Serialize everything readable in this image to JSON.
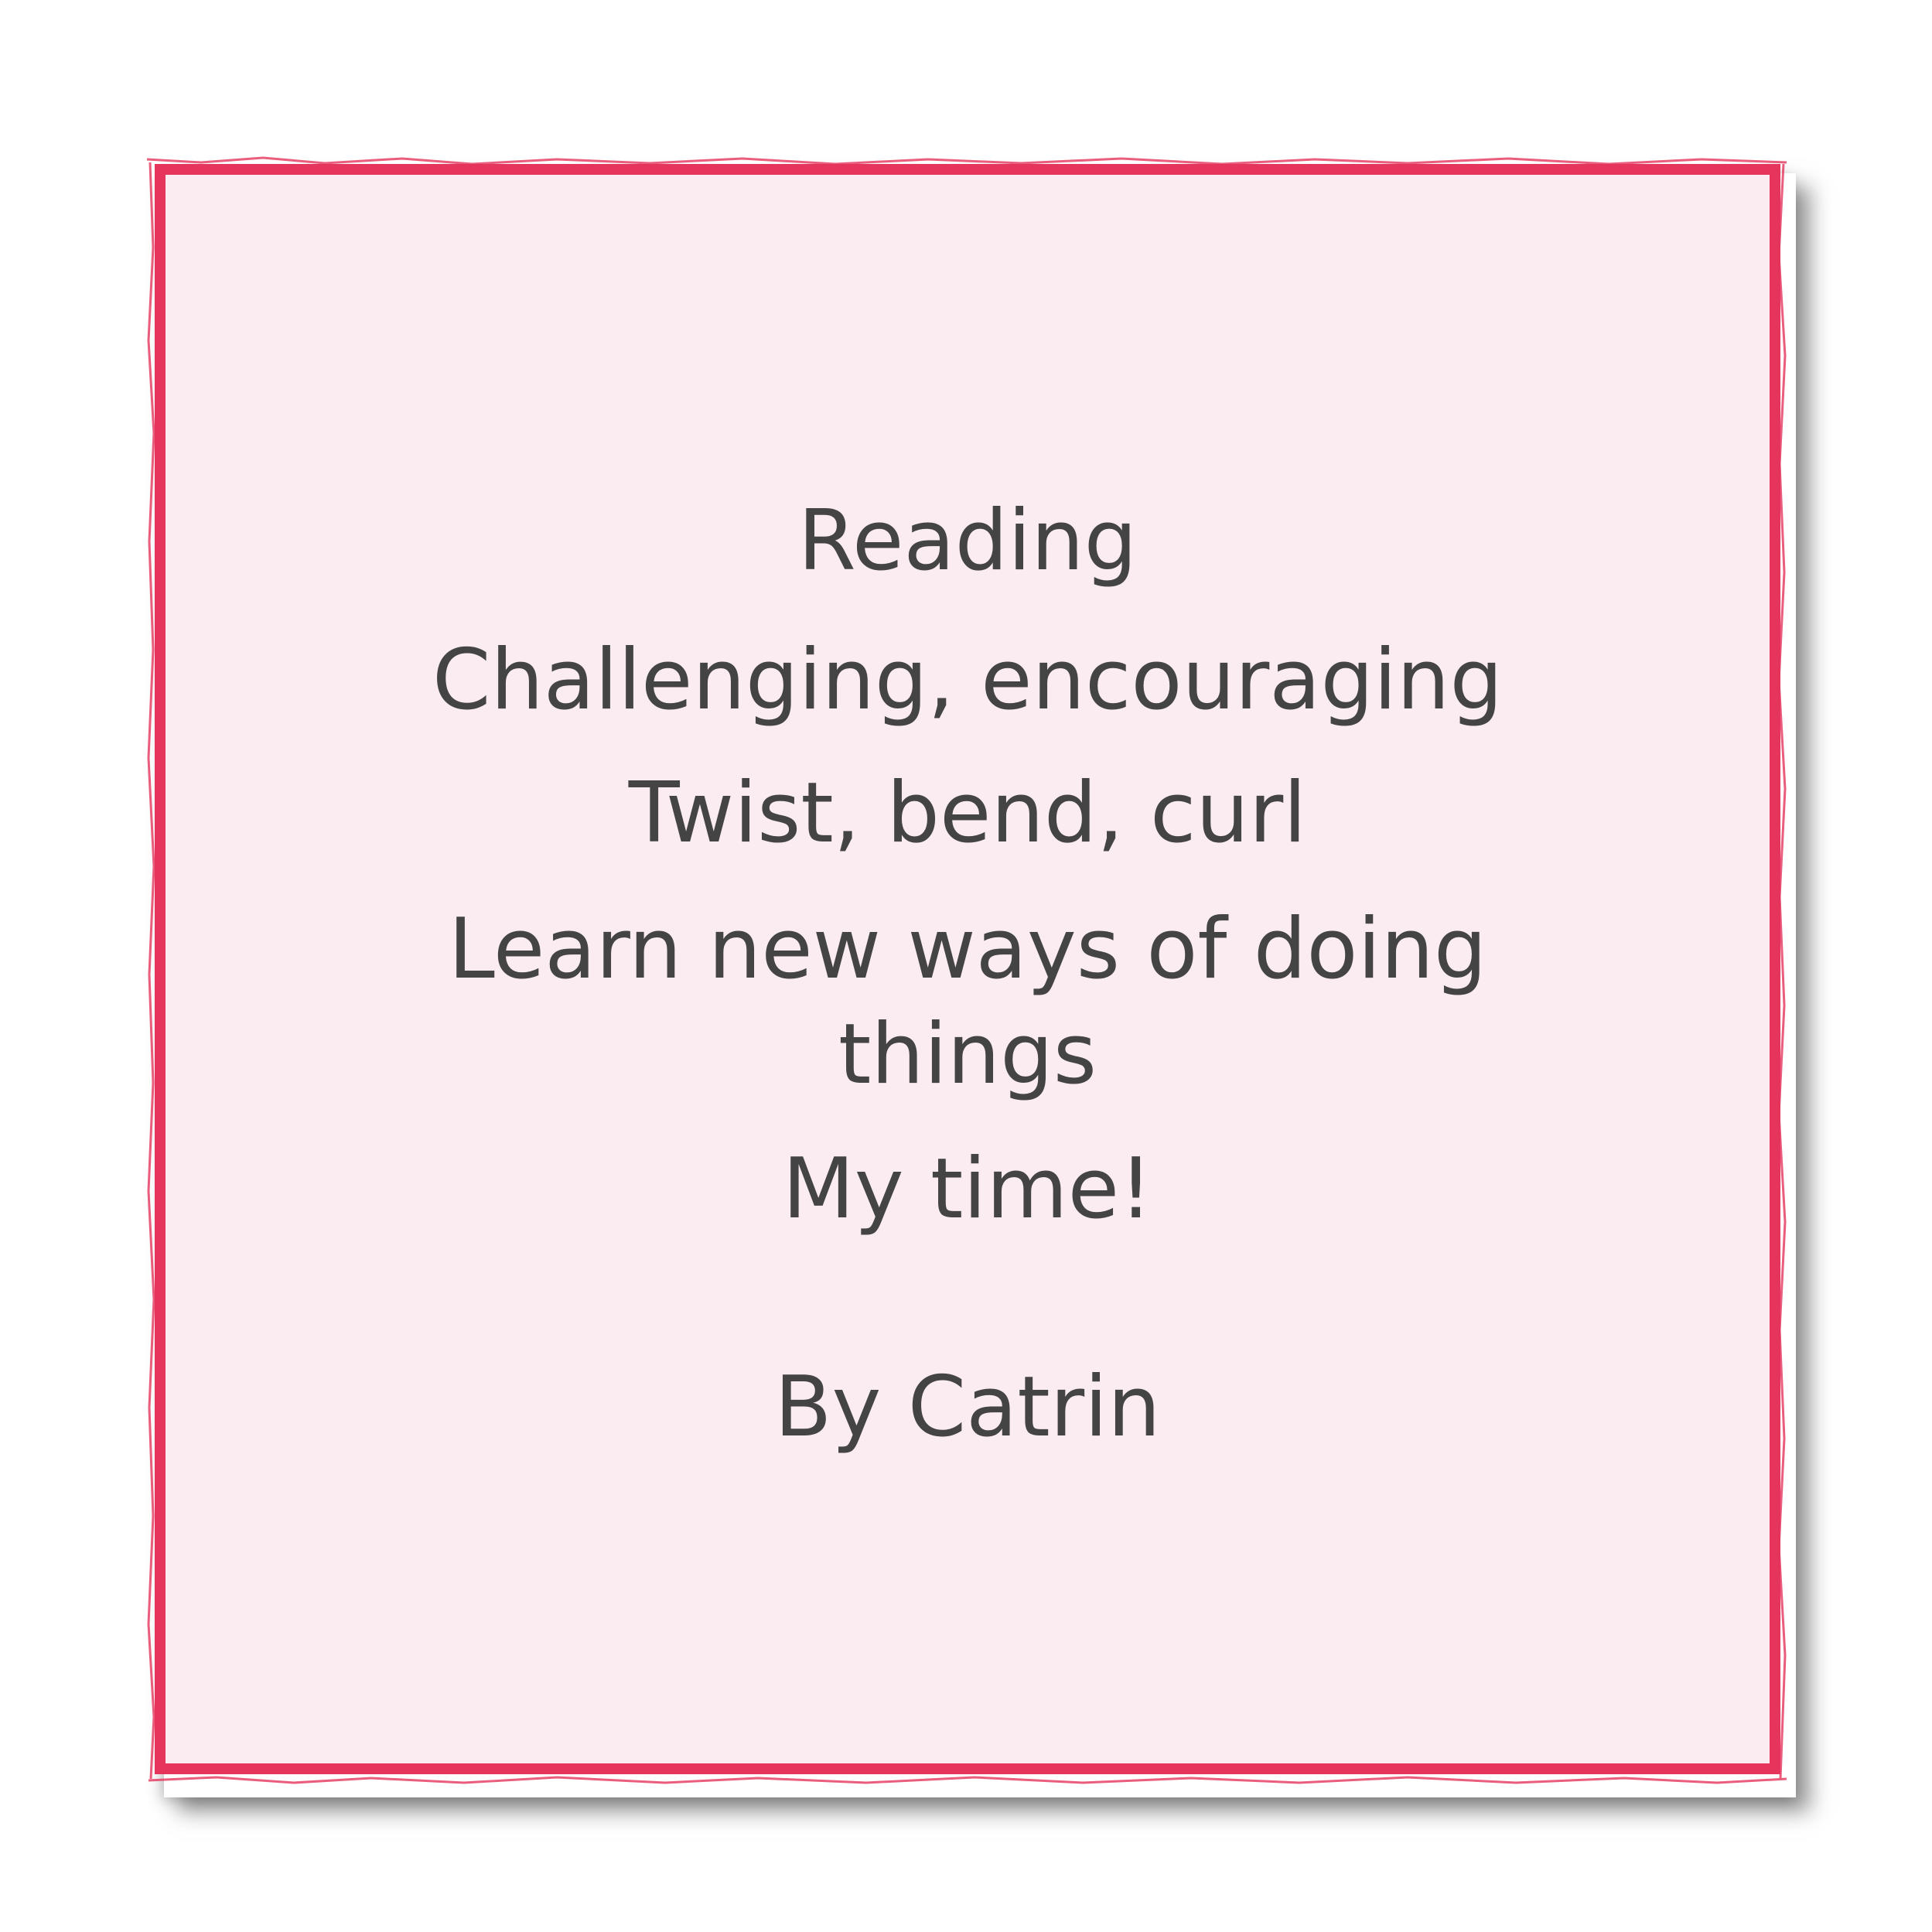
{
  "poem": {
    "lines": [
      "Reading",
      "Challenging, encouraging",
      "Twist, bend, curl",
      "Learn new ways of doing",
      "things",
      "My time!"
    ],
    "author": "By Catrin"
  },
  "colors": {
    "border": "#e5355d",
    "card_background": "#fbecf1",
    "text": "#444444"
  }
}
